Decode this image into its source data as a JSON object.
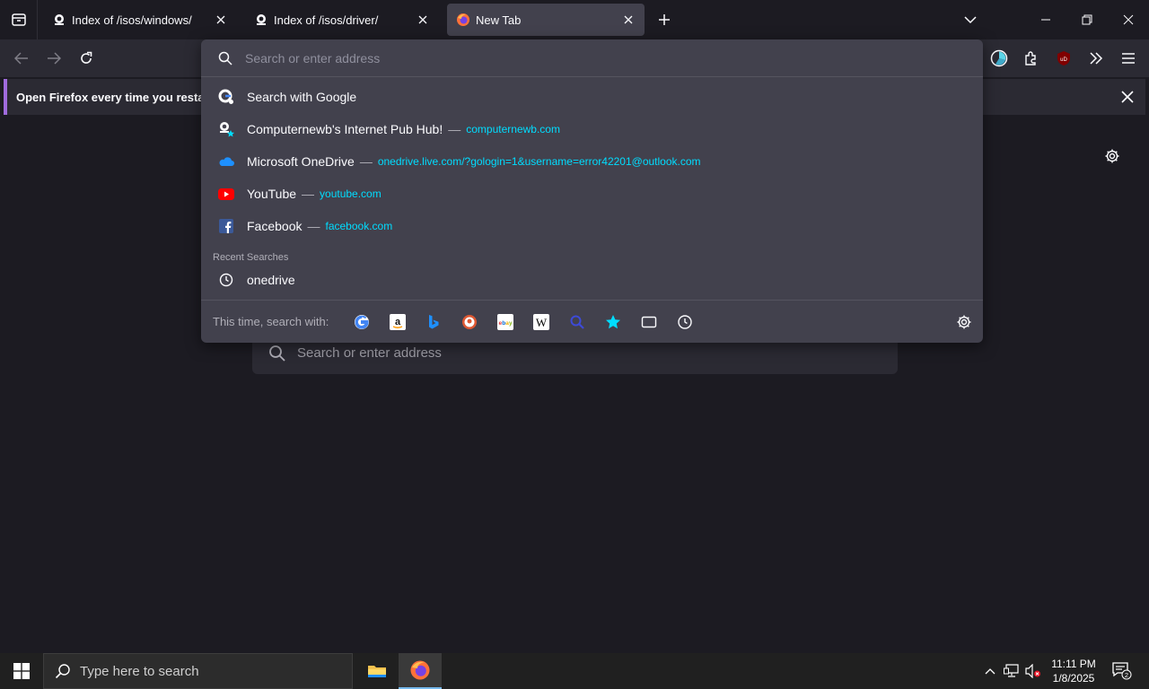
{
  "tabs": [
    {
      "title": "Index of /isos/windows/",
      "favicon": "globe-icon",
      "selected": false
    },
    {
      "title": "Index of /isos/driver/",
      "favicon": "globe-icon",
      "selected": false
    },
    {
      "title": "New Tab",
      "favicon": "firefox-icon",
      "selected": true
    }
  ],
  "notification": {
    "text": "Open Firefox every time you restart y"
  },
  "urlbar": {
    "placeholder": "Search or enter address",
    "results": [
      {
        "title": "Search with Google",
        "url": "",
        "icon": "google-search-icon"
      },
      {
        "title": "Computernewb's Internet Pub Hub!",
        "url": "computernewb.com",
        "icon": "bookmark-globe-icon"
      },
      {
        "title": "Microsoft OneDrive",
        "url": "onedrive.live.com/?gologin=1&username=error42201@outlook.com",
        "icon": "onedrive-icon"
      },
      {
        "title": "YouTube",
        "url": "youtube.com",
        "icon": "youtube-icon"
      },
      {
        "title": "Facebook",
        "url": "facebook.com",
        "icon": "facebook-icon"
      }
    ],
    "recent_label": "Recent Searches",
    "recent": [
      {
        "title": "onedrive",
        "icon": "history-icon"
      }
    ],
    "separator": "—",
    "oneoff_label": "This time, search with:",
    "engines": [
      "google-icon",
      "amazon-icon",
      "bing-icon",
      "duckduckgo-icon",
      "ebay-icon",
      "wikipedia-icon",
      "search-icon",
      "bookmarks-icon",
      "tabs-icon",
      "history-icon"
    ]
  },
  "page": {
    "search_placeholder": "Search or enter address"
  },
  "taskbar": {
    "search_text": "Type here to search",
    "time": "11:11 PM",
    "date": "1/8/2025",
    "notification_count": "2"
  },
  "colors": {
    "accent": "#00ddff",
    "notification_border": "#a06bdd",
    "panel": "#42414d"
  }
}
